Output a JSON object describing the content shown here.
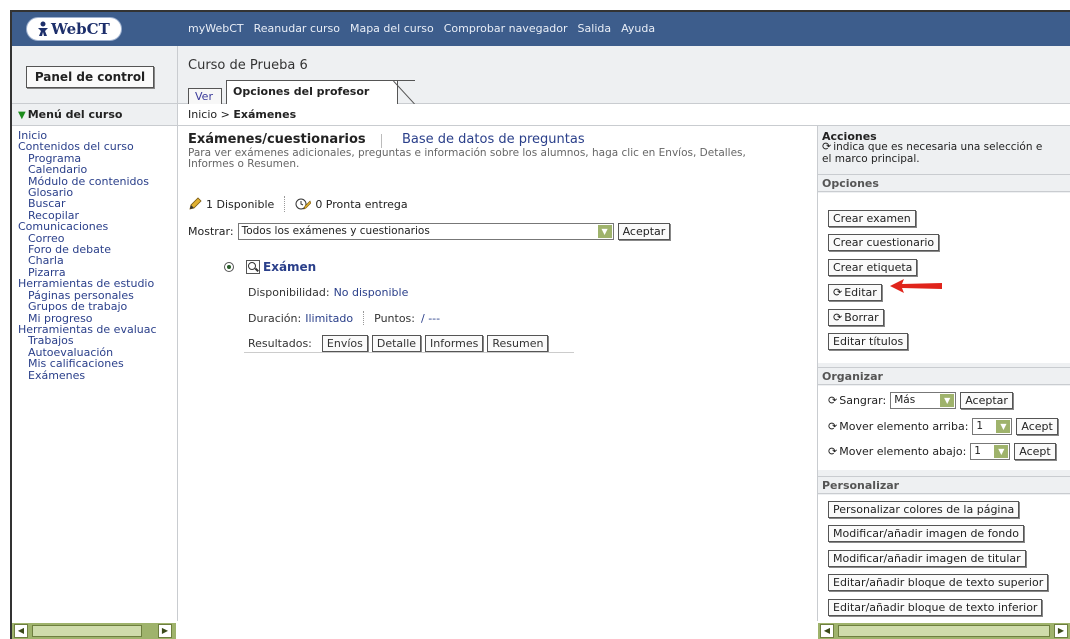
{
  "topbar": {
    "logo": "WebCT",
    "nav": [
      "myWebCT",
      "Reanudar curso",
      "Mapa del curso",
      "Comprobar navegador",
      "Salida",
      "Ayuda"
    ]
  },
  "header": {
    "control_panel": "Panel de control",
    "course_title": "Curso de Prueba 6",
    "tab_view": "Ver",
    "tab_teacher": "Opciones del profesor"
  },
  "menu": {
    "title": "Menú del curso",
    "items": [
      {
        "label": "Inicio",
        "sub": false
      },
      {
        "label": "Contenidos del curso",
        "sub": false
      },
      {
        "label": "Programa",
        "sub": true
      },
      {
        "label": "Calendario",
        "sub": true
      },
      {
        "label": "Módulo de contenidos",
        "sub": true
      },
      {
        "label": "Glosario",
        "sub": true
      },
      {
        "label": "Buscar",
        "sub": true
      },
      {
        "label": "Recopilar",
        "sub": true
      },
      {
        "label": "Comunicaciones",
        "sub": false
      },
      {
        "label": "Correo",
        "sub": true
      },
      {
        "label": "Foro de debate",
        "sub": true
      },
      {
        "label": "Charla",
        "sub": true
      },
      {
        "label": "Pizarra",
        "sub": true
      },
      {
        "label": "Herramientas de estudio",
        "sub": false
      },
      {
        "label": "Páginas personales",
        "sub": true
      },
      {
        "label": "Grupos de trabajo",
        "sub": true
      },
      {
        "label": "Mi progreso",
        "sub": true
      },
      {
        "label": "Herramientas de evaluac",
        "sub": false
      },
      {
        "label": "Trabajos",
        "sub": true
      },
      {
        "label": "Autoevaluación",
        "sub": true
      },
      {
        "label": "Mis calificaciones",
        "sub": true
      },
      {
        "label": "Exámenes",
        "sub": true
      }
    ]
  },
  "breadcrumb": {
    "home": "Inicio",
    "sep": ">",
    "current": "Exámenes"
  },
  "main": {
    "title": "Exámenes/cuestionarios",
    "question_db": "Base de datos de preguntas",
    "desc": "Para ver exámenes adicionales, preguntas e información sobre los alumnos, haga clic en Envíos, Detalles, Informes o Resumen.",
    "available": "1 Disponible",
    "ready": "0 Pronta entrega",
    "show_label": "Mostrar:",
    "show_value": "Todos los exámenes y cuestionarios",
    "accept": "Aceptar",
    "exam": {
      "name": "Exámen",
      "availability_label": "Disponibilidad:",
      "availability_value": "No disponible",
      "duration_label": "Duración:",
      "duration_value": "Ilimitado",
      "points_label": "Puntos:",
      "points_value": "/ ---",
      "results_label": "Resultados:",
      "results_buttons": [
        "Envíos",
        "Detalle",
        "Informes",
        "Resumen"
      ]
    }
  },
  "actions": {
    "title": "Acciones",
    "note1": "indica que es necesaria una selección e",
    "note2": "el marco principal.",
    "options_title": "Opciones",
    "options": [
      "Crear examen",
      "Crear cuestionario",
      "Crear etiqueta",
      "Editar",
      "Borrar",
      "Editar títulos"
    ],
    "organize_title": "Organizar",
    "indent_label": "Sangrar:",
    "indent_value": "Más",
    "accept": "Aceptar",
    "accept_cut": "Acept",
    "move_up_label": "Mover elemento arriba:",
    "move_down_label": "Mover elemento abajo:",
    "position_value": "1",
    "customize_title": "Personalizar",
    "customize": [
      "Personalizar colores de la página",
      "Modificar/añadir imagen de fondo",
      "Modificar/añadir imagen de titular",
      "Editar/añadir bloque de texto superior",
      "Editar/añadir bloque de texto inferior"
    ]
  },
  "colors": {
    "topbar": "#3d5d8c",
    "link": "#2a3f8a",
    "scrollbar": "#9fb36c",
    "arrow": "#e0241b"
  }
}
